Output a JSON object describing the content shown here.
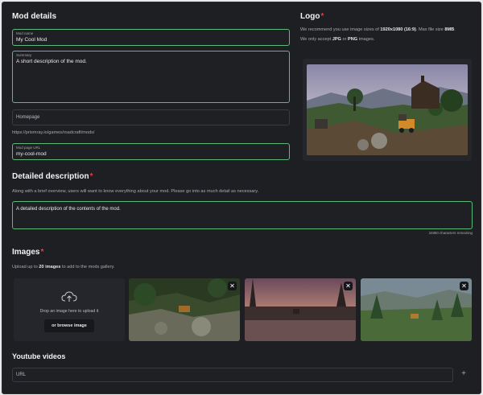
{
  "mod_details": {
    "title": "Mod details",
    "mod_name_label": "Mod name",
    "mod_name_value": "My Cool Mod",
    "summary_label": "Summary",
    "summary_value": "A short description of the mod.",
    "homepage_placeholder": "Homepage",
    "url_prefix": "https://prismray.io/games/roadcraft/mods/",
    "url_label": "Mod page URL",
    "url_value": "my-cool-mod"
  },
  "logo": {
    "title": "Logo",
    "help_line1_pre": "We recommend you use image sizes of",
    "help_size": "1920x1080 (16:9)",
    "help_line1_mid": ". Max file size",
    "help_max": "8MB",
    "help_line2_pre": "We only accept",
    "help_jpg": "JPG",
    "help_or": "or",
    "help_png": "PNG",
    "help_line2_post": "images."
  },
  "detailed": {
    "title": "Detailed description",
    "help": "Along with a brief overview, users will want to know everything about your mod. Please go into as much detail as necessary.",
    "value": "A detailed description of the contents of the mod.",
    "remaining": "24850 characters remaining"
  },
  "images": {
    "title": "Images",
    "help_pre": "Upload up to",
    "help_count": "20 images",
    "help_post": "to add to the mods gallery.",
    "drop_text": "Drop an image here to upload it",
    "browse_label": "or browse image",
    "remove_symbol": "✕"
  },
  "youtube": {
    "title": "Youtube videos",
    "url_placeholder": "URL",
    "add_symbol": "+"
  },
  "colors": {
    "accent_focus": "#5fb77a",
    "required": "#e0404a",
    "background": "#1e1f23"
  },
  "icons": [
    "upload-cloud-icon",
    "close-icon",
    "plus-icon"
  ]
}
